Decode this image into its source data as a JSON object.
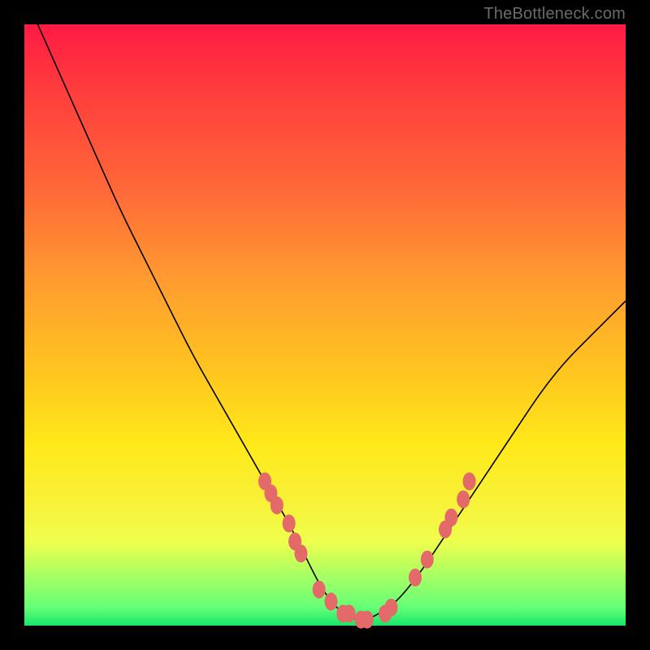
{
  "watermark": "TheBottleneck.com",
  "colors": {
    "curve_stroke": "#000000",
    "marker_fill": "#e46a6a",
    "marker_stroke": "#d85a5a"
  },
  "chart_data": {
    "type": "line",
    "title": "",
    "xlabel": "",
    "ylabel": "",
    "xlim": [
      0,
      100
    ],
    "ylim": [
      0,
      100
    ],
    "x": [
      0,
      4,
      8,
      12,
      16,
      20,
      24,
      28,
      32,
      36,
      40,
      44,
      47,
      49,
      51,
      53,
      55,
      57,
      59,
      62,
      66,
      70,
      74,
      78,
      82,
      86,
      90,
      94,
      100
    ],
    "values": [
      105,
      96,
      87,
      78,
      69,
      61,
      53,
      45,
      38,
      31,
      24,
      17,
      11,
      7,
      4,
      2,
      1,
      1,
      2,
      4,
      9,
      15,
      21,
      27,
      33,
      39,
      44,
      48,
      54
    ],
    "marker_points": [
      {
        "x": 40,
        "y": 24
      },
      {
        "x": 41,
        "y": 22
      },
      {
        "x": 42,
        "y": 20
      },
      {
        "x": 44,
        "y": 17
      },
      {
        "x": 45,
        "y": 14
      },
      {
        "x": 46,
        "y": 12
      },
      {
        "x": 49,
        "y": 6
      },
      {
        "x": 51,
        "y": 4
      },
      {
        "x": 53,
        "y": 2
      },
      {
        "x": 54,
        "y": 2
      },
      {
        "x": 56,
        "y": 1
      },
      {
        "x": 57,
        "y": 1
      },
      {
        "x": 60,
        "y": 2
      },
      {
        "x": 61,
        "y": 3
      },
      {
        "x": 65,
        "y": 8
      },
      {
        "x": 67,
        "y": 11
      },
      {
        "x": 70,
        "y": 16
      },
      {
        "x": 71,
        "y": 18
      },
      {
        "x": 73,
        "y": 21
      },
      {
        "x": 74,
        "y": 24
      }
    ]
  }
}
